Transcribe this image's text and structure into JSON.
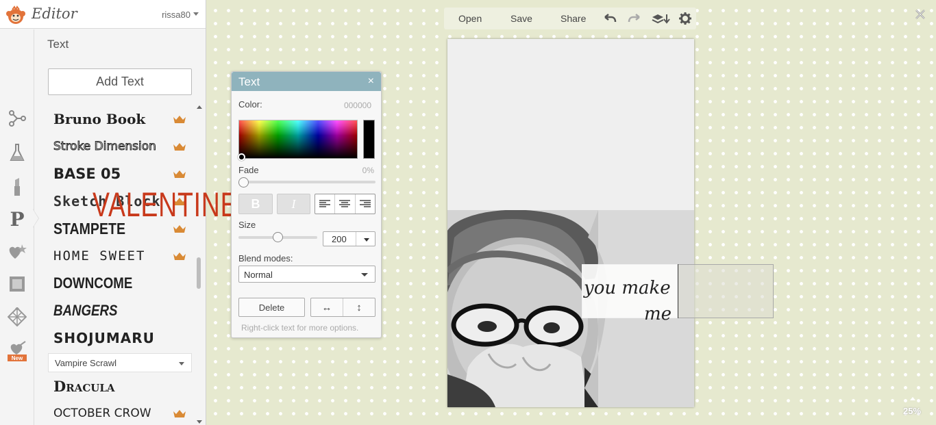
{
  "app": {
    "title": "Editor",
    "user": "rissa80"
  },
  "panel": {
    "title": "Text",
    "add_text_label": "Add Text"
  },
  "fonts": [
    {
      "name": "Bruno Book",
      "premium": true
    },
    {
      "name": "Stroke Dimension",
      "premium": true
    },
    {
      "name": "BASE 05",
      "premium": true
    },
    {
      "name": "Sketch Block",
      "premium": true
    },
    {
      "name": "STAMPETE",
      "premium": true
    },
    {
      "name": "HOME SWEET",
      "premium": true
    },
    {
      "name": "DOWNCOME",
      "premium": false
    },
    {
      "name": "BANGERS",
      "premium": false
    },
    {
      "name": "SHOJUMARU",
      "premium": false
    },
    {
      "name": "Dracula",
      "premium": false
    },
    {
      "name": "OCTOBER CROW",
      "premium": true
    }
  ],
  "font_select": {
    "value": "Vampire Scrawl"
  },
  "toolbar": {
    "open": "Open",
    "save": "Save",
    "share": "Share"
  },
  "text_panel": {
    "title": "Text",
    "close": "×",
    "color_label": "Color:",
    "color_value": "000000",
    "fade_label": "Fade",
    "fade_value": "0%",
    "bold": "B",
    "italic": "I",
    "size_label": "Size",
    "size_value": "200",
    "blend_label": "Blend modes:",
    "blend_value": "Normal",
    "delete_label": "Delete",
    "flip_h": "↔",
    "flip_v": "↕",
    "hint": "Right-click text for more options."
  },
  "canvas": {
    "text_main": "VALENTINE",
    "text_line1": "you make",
    "text_line2": "me",
    "accent_color": "#c8391b"
  },
  "zoom": {
    "value": "25%"
  },
  "colors": {
    "header": "#8fb3bd",
    "crown": "#d98a35"
  }
}
